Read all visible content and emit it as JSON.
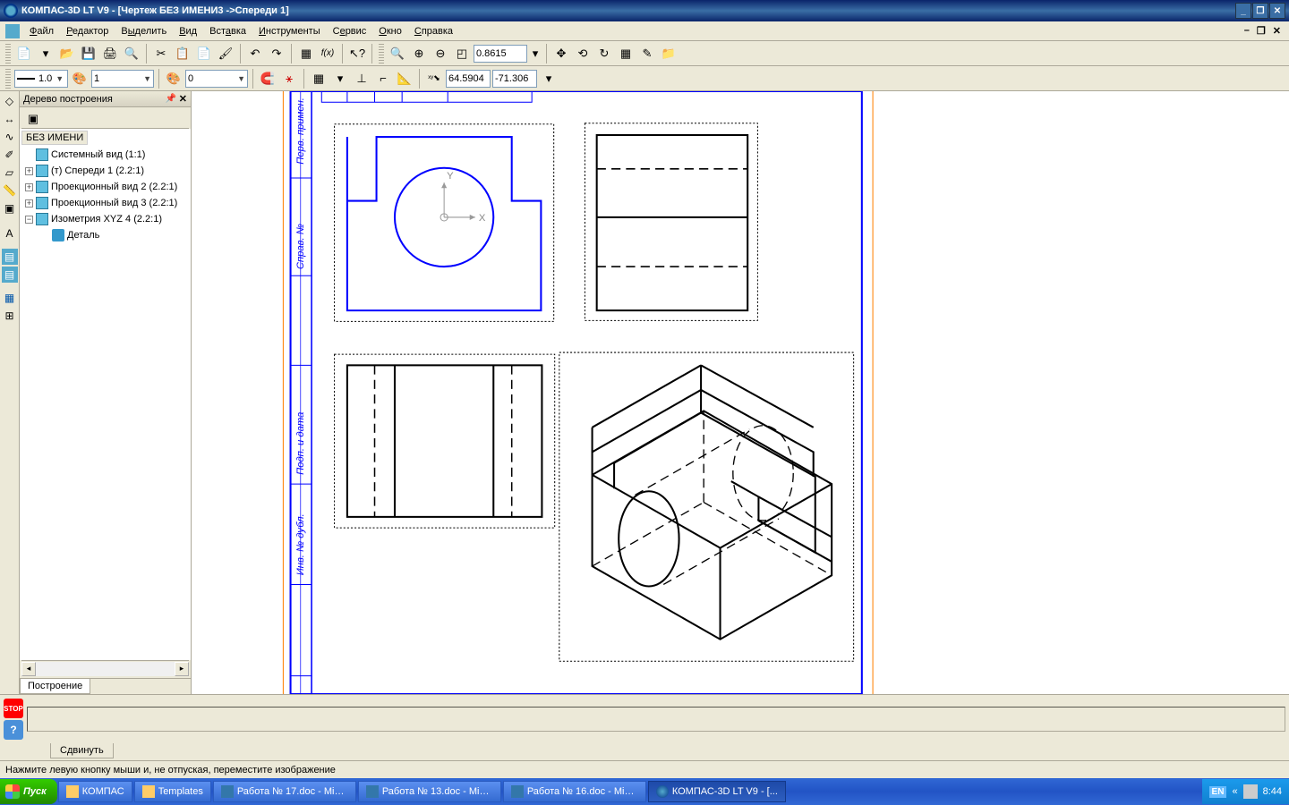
{
  "titlebar": {
    "title": "КОМПАС-3D LT V9 - [Чертеж БЕЗ ИМЕНИ3 ->Спереди 1]"
  },
  "menu": {
    "file": "Файл",
    "editor": "Редактор",
    "select": "Выделить",
    "view": "Вид",
    "insert": "Вставка",
    "tools": "Инструменты",
    "service": "Сервис",
    "window": "Окно",
    "help": "Справка"
  },
  "toolbar": {
    "zoom_value": "0.8615",
    "line_width": "1.0",
    "layer": "1",
    "color_num": "0",
    "coord_x": "64.5904",
    "coord_y": "-71.306"
  },
  "tree": {
    "title": "Дерево построения",
    "root": "БЕЗ ИМЕНИ",
    "items": [
      "Системный вид (1:1)",
      "(т) Спереди 1 (2.2:1)",
      "Проекционный вид 2 (2.2:1)",
      "Проекционный вид 3 (2.2:1)",
      "Изометрия XYZ 4 (2.2:1)"
    ],
    "detail": "Деталь",
    "tab": "Построение"
  },
  "property": {
    "tab": "Сдвинуть"
  },
  "status": {
    "hint": "Нажмите левую кнопку мыши и, не отпуская, переместите изображение"
  },
  "taskbar": {
    "start": "Пуск",
    "items": [
      "КОМПАС",
      "Templates",
      "Работа № 17.doc - Micr...",
      "Работа № 13.doc - Micr...",
      "Работа № 16.doc - Micr...",
      "КОМПАС-3D LT V9 - [..."
    ],
    "lang": "EN",
    "time": "8:44",
    "expand": "«"
  }
}
